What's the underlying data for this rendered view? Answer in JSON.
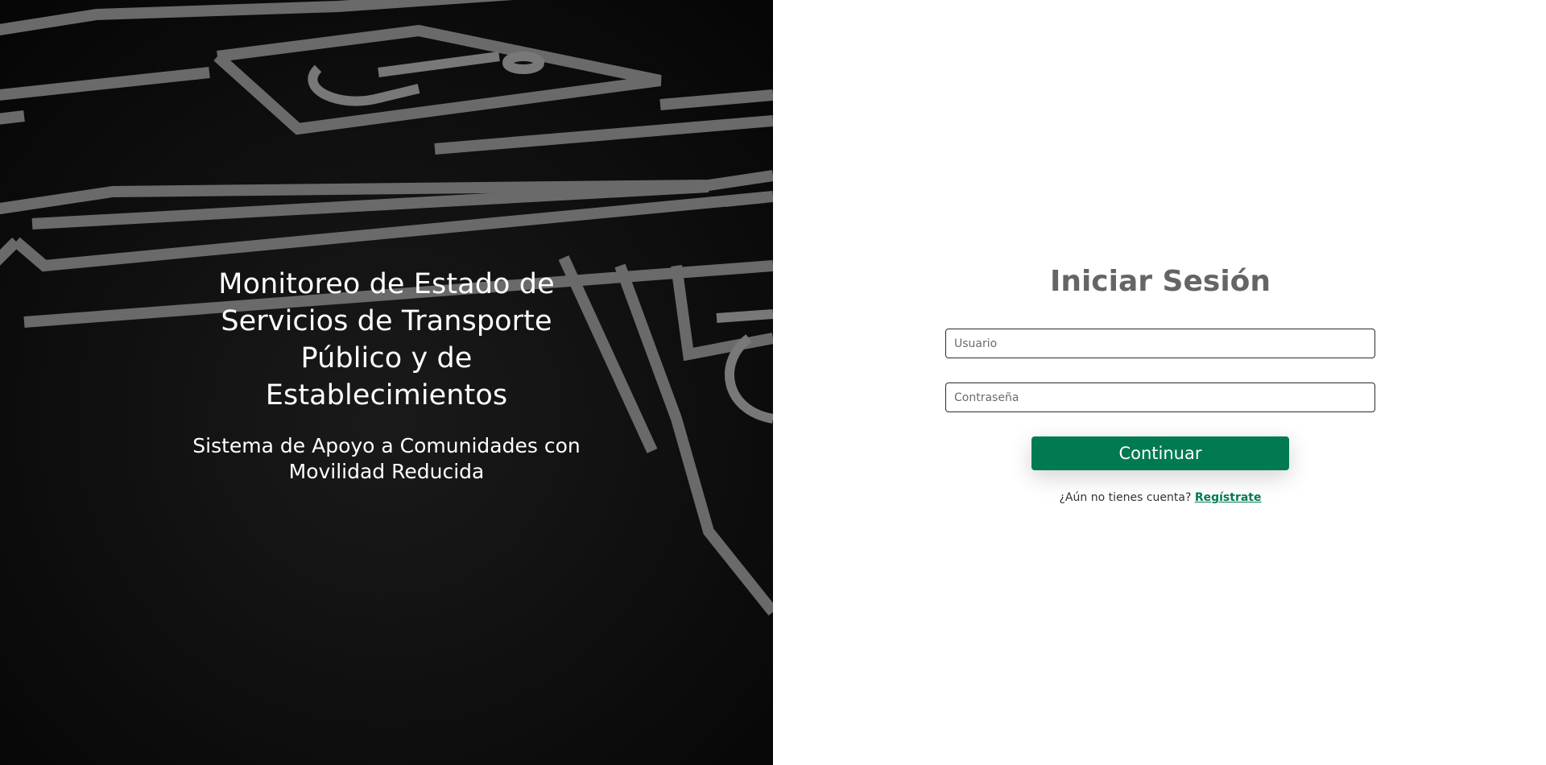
{
  "hero": {
    "title": "Monitoreo de Estado de Servicios de Transporte Público y de Establecimientos",
    "subtitle": "Sistema de Apoyo a Comunidades con Movilidad Reducida",
    "background_image": "parking-lot-accessible-spaces"
  },
  "login": {
    "title": "Iniciar Sesión",
    "username_placeholder": "Usuario",
    "username_value": "",
    "password_placeholder": "Contraseña",
    "password_value": "",
    "submit_label": "Continuar",
    "register_prompt": "¿Aún no tienes cuenta?",
    "register_link": "Regístrate"
  },
  "colors": {
    "accent": "#017a52",
    "title_gray": "#656565",
    "hero_bg": "#0c0c0c"
  }
}
